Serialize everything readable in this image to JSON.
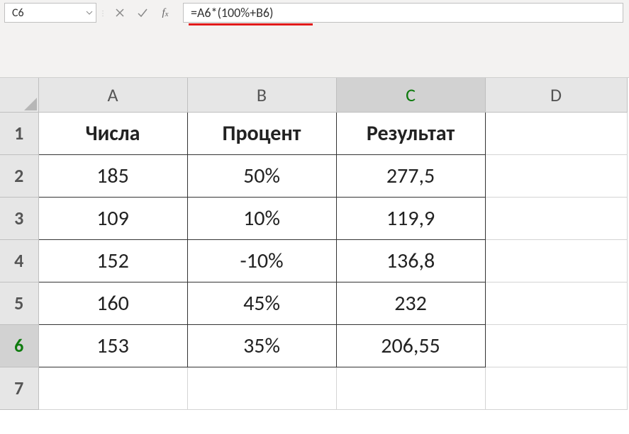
{
  "name_box": "C6",
  "formula": "=A6*(100%+B6)",
  "columns": [
    "A",
    "B",
    "C",
    "D"
  ],
  "active_col": "C",
  "active_row": "6",
  "rows": [
    "1",
    "2",
    "3",
    "4",
    "5",
    "6",
    "7"
  ],
  "headers": {
    "a": "Числа",
    "b": "Процент",
    "c": "Результат"
  },
  "data": [
    {
      "a": "185",
      "b": "50%",
      "c": "277,5"
    },
    {
      "a": "109",
      "b": "10%",
      "c": "119,9"
    },
    {
      "a": "152",
      "b": "-10%",
      "c": "136,8"
    },
    {
      "a": "160",
      "b": "45%",
      "c": "232"
    },
    {
      "a": "153",
      "b": "35%",
      "c": "206,55"
    }
  ]
}
